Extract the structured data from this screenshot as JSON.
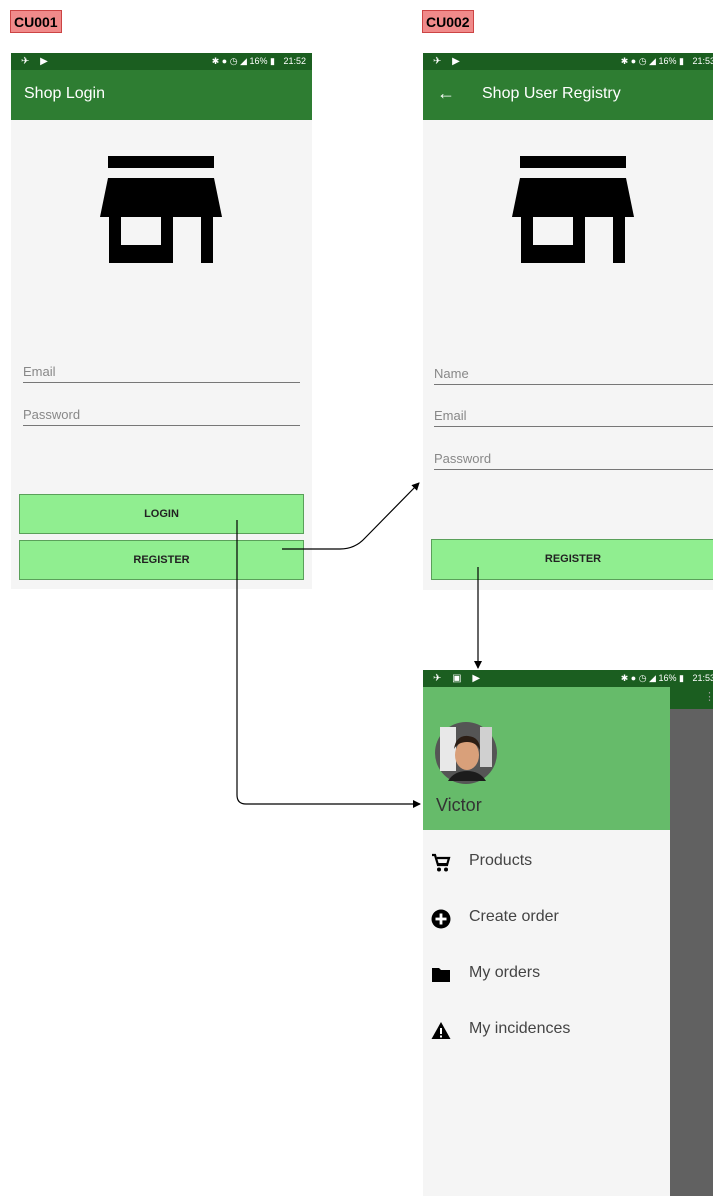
{
  "screens": [
    {
      "tag": "CU001",
      "status": {
        "battery": "16%",
        "time": "21:52"
      },
      "appbar_title": "Shop Login",
      "fields": [
        "Email",
        "Password"
      ],
      "login_label": "LOGIN",
      "register_label": "REGISTER"
    },
    {
      "tag": "CU002",
      "status": {
        "battery": "16%",
        "time": "21:53"
      },
      "appbar_title": "Shop User Registry",
      "fields": [
        "Name",
        "Email",
        "Password"
      ],
      "register_label": "REGISTER"
    },
    {
      "status": {
        "battery": "16%",
        "time": "21:53"
      },
      "drawer": {
        "user_name": "Victor",
        "items": [
          {
            "label": "Products",
            "icon": "cart-icon"
          },
          {
            "label": "Create order",
            "icon": "add-circle-icon"
          },
          {
            "label": "My orders",
            "icon": "folder-icon"
          },
          {
            "label": "My incidences",
            "icon": "warning-icon"
          }
        ]
      }
    }
  ],
  "colors": {
    "status_bar": "#1b5e20",
    "app_bar": "#2e7d32",
    "drawer_header": "#66bb6a",
    "button": "#90ee90",
    "tag": "#f08a8a"
  }
}
